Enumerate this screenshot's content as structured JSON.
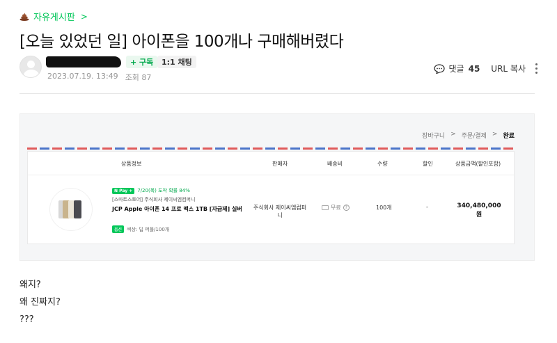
{
  "board": {
    "label": "자유게시판",
    "chevron": ">"
  },
  "post": {
    "title": "[오늘 있었던 일] 아이폰을 100개나 구매해버렸다",
    "subscribe_label": "+ 구독",
    "chat_label": "1:1 채팅",
    "date": "2023.07.19. 13:49",
    "views_label": "조회 87",
    "comments_label": "댓글",
    "comments_count": "45",
    "url_copy_label": "URL 복사",
    "body_lines": [
      "왜지?",
      "왜 진짜지?",
      "???"
    ]
  },
  "order_screenshot": {
    "crumbs": [
      "장바구니",
      ">",
      "주문/결제",
      ">",
      "완료"
    ],
    "headers": {
      "product": "상품정보",
      "seller": "판매자",
      "shipping": "배송비",
      "qty": "수량",
      "discount": "할인",
      "total": "상품금액(할인포함)"
    },
    "item": {
      "npay_badge": "N Pay +",
      "arrival": "7/20(목) 도착 확률 84%",
      "seller_line": "[스마트스토어] 주식회사 제이씨엠컴퍼니",
      "name": "JCP Apple 아이폰 14 프로 맥스 1TB [자급제] 실버",
      "option_badge": "옵션",
      "option_text": "색상: 딥 퍼플/100개",
      "seller": "주식회사 제이씨엠컴퍼니",
      "shipping": "무료",
      "qty": "100개",
      "discount": "-",
      "price": "340,480,000",
      "price_unit": "원"
    }
  },
  "colors": {
    "accent": "#03c75a",
    "envelope_red": "#e05a5a",
    "envelope_blue": "#4a74c9"
  }
}
